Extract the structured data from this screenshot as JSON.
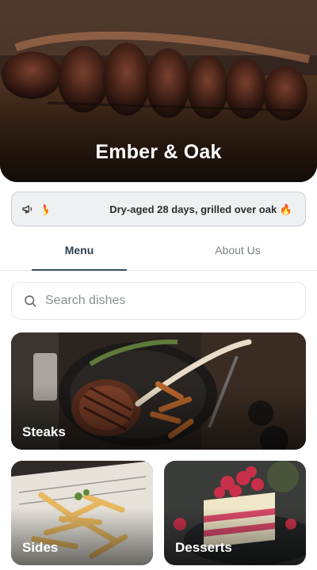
{
  "restaurant": {
    "name": "Ember & Oak"
  },
  "announcement": {
    "icon": "megaphone-icon",
    "ghost_text": "🔥",
    "text": "Dry-aged 28 days, grilled over oak 🔥"
  },
  "tabs": [
    {
      "label": "Menu",
      "active": true
    },
    {
      "label": "About Us",
      "active": false
    }
  ],
  "search": {
    "placeholder": "Search dishes",
    "value": ""
  },
  "categories": [
    {
      "label": "Steaks"
    },
    {
      "label": "Sides"
    },
    {
      "label": "Desserts"
    }
  ],
  "colors": {
    "accent": "#3b4e63",
    "announcement_bg": "#eef0f2",
    "tab_inactive": "#7a8088"
  }
}
